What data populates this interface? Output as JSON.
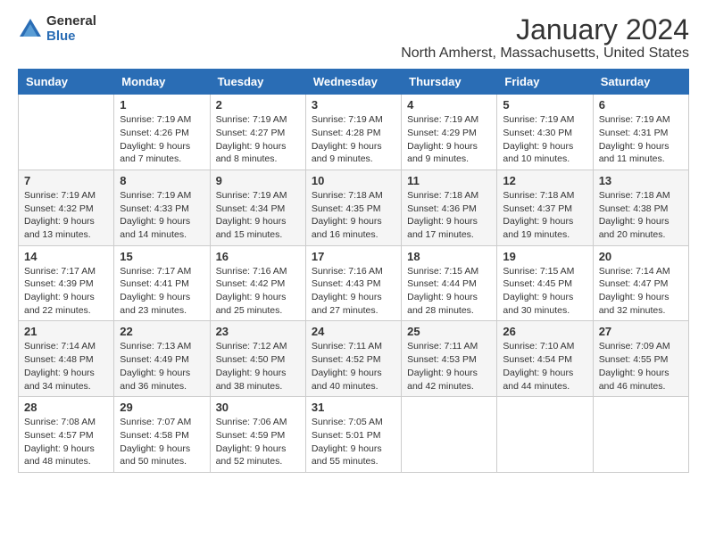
{
  "logo": {
    "general": "General",
    "blue": "Blue"
  },
  "title": "January 2024",
  "subtitle": "North Amherst, Massachusetts, United States",
  "weekdays": [
    "Sunday",
    "Monday",
    "Tuesday",
    "Wednesday",
    "Thursday",
    "Friday",
    "Saturday"
  ],
  "weeks": [
    [
      {
        "day": "",
        "sunrise": "",
        "sunset": "",
        "daylight": ""
      },
      {
        "day": "1",
        "sunrise": "Sunrise: 7:19 AM",
        "sunset": "Sunset: 4:26 PM",
        "daylight": "Daylight: 9 hours and 7 minutes."
      },
      {
        "day": "2",
        "sunrise": "Sunrise: 7:19 AM",
        "sunset": "Sunset: 4:27 PM",
        "daylight": "Daylight: 9 hours and 8 minutes."
      },
      {
        "day": "3",
        "sunrise": "Sunrise: 7:19 AM",
        "sunset": "Sunset: 4:28 PM",
        "daylight": "Daylight: 9 hours and 9 minutes."
      },
      {
        "day": "4",
        "sunrise": "Sunrise: 7:19 AM",
        "sunset": "Sunset: 4:29 PM",
        "daylight": "Daylight: 9 hours and 9 minutes."
      },
      {
        "day": "5",
        "sunrise": "Sunrise: 7:19 AM",
        "sunset": "Sunset: 4:30 PM",
        "daylight": "Daylight: 9 hours and 10 minutes."
      },
      {
        "day": "6",
        "sunrise": "Sunrise: 7:19 AM",
        "sunset": "Sunset: 4:31 PM",
        "daylight": "Daylight: 9 hours and 11 minutes."
      }
    ],
    [
      {
        "day": "7",
        "sunrise": "Sunrise: 7:19 AM",
        "sunset": "Sunset: 4:32 PM",
        "daylight": "Daylight: 9 hours and 13 minutes."
      },
      {
        "day": "8",
        "sunrise": "Sunrise: 7:19 AM",
        "sunset": "Sunset: 4:33 PM",
        "daylight": "Daylight: 9 hours and 14 minutes."
      },
      {
        "day": "9",
        "sunrise": "Sunrise: 7:19 AM",
        "sunset": "Sunset: 4:34 PM",
        "daylight": "Daylight: 9 hours and 15 minutes."
      },
      {
        "day": "10",
        "sunrise": "Sunrise: 7:18 AM",
        "sunset": "Sunset: 4:35 PM",
        "daylight": "Daylight: 9 hours and 16 minutes."
      },
      {
        "day": "11",
        "sunrise": "Sunrise: 7:18 AM",
        "sunset": "Sunset: 4:36 PM",
        "daylight": "Daylight: 9 hours and 17 minutes."
      },
      {
        "day": "12",
        "sunrise": "Sunrise: 7:18 AM",
        "sunset": "Sunset: 4:37 PM",
        "daylight": "Daylight: 9 hours and 19 minutes."
      },
      {
        "day": "13",
        "sunrise": "Sunrise: 7:18 AM",
        "sunset": "Sunset: 4:38 PM",
        "daylight": "Daylight: 9 hours and 20 minutes."
      }
    ],
    [
      {
        "day": "14",
        "sunrise": "Sunrise: 7:17 AM",
        "sunset": "Sunset: 4:39 PM",
        "daylight": "Daylight: 9 hours and 22 minutes."
      },
      {
        "day": "15",
        "sunrise": "Sunrise: 7:17 AM",
        "sunset": "Sunset: 4:41 PM",
        "daylight": "Daylight: 9 hours and 23 minutes."
      },
      {
        "day": "16",
        "sunrise": "Sunrise: 7:16 AM",
        "sunset": "Sunset: 4:42 PM",
        "daylight": "Daylight: 9 hours and 25 minutes."
      },
      {
        "day": "17",
        "sunrise": "Sunrise: 7:16 AM",
        "sunset": "Sunset: 4:43 PM",
        "daylight": "Daylight: 9 hours and 27 minutes."
      },
      {
        "day": "18",
        "sunrise": "Sunrise: 7:15 AM",
        "sunset": "Sunset: 4:44 PM",
        "daylight": "Daylight: 9 hours and 28 minutes."
      },
      {
        "day": "19",
        "sunrise": "Sunrise: 7:15 AM",
        "sunset": "Sunset: 4:45 PM",
        "daylight": "Daylight: 9 hours and 30 minutes."
      },
      {
        "day": "20",
        "sunrise": "Sunrise: 7:14 AM",
        "sunset": "Sunset: 4:47 PM",
        "daylight": "Daylight: 9 hours and 32 minutes."
      }
    ],
    [
      {
        "day": "21",
        "sunrise": "Sunrise: 7:14 AM",
        "sunset": "Sunset: 4:48 PM",
        "daylight": "Daylight: 9 hours and 34 minutes."
      },
      {
        "day": "22",
        "sunrise": "Sunrise: 7:13 AM",
        "sunset": "Sunset: 4:49 PM",
        "daylight": "Daylight: 9 hours and 36 minutes."
      },
      {
        "day": "23",
        "sunrise": "Sunrise: 7:12 AM",
        "sunset": "Sunset: 4:50 PM",
        "daylight": "Daylight: 9 hours and 38 minutes."
      },
      {
        "day": "24",
        "sunrise": "Sunrise: 7:11 AM",
        "sunset": "Sunset: 4:52 PM",
        "daylight": "Daylight: 9 hours and 40 minutes."
      },
      {
        "day": "25",
        "sunrise": "Sunrise: 7:11 AM",
        "sunset": "Sunset: 4:53 PM",
        "daylight": "Daylight: 9 hours and 42 minutes."
      },
      {
        "day": "26",
        "sunrise": "Sunrise: 7:10 AM",
        "sunset": "Sunset: 4:54 PM",
        "daylight": "Daylight: 9 hours and 44 minutes."
      },
      {
        "day": "27",
        "sunrise": "Sunrise: 7:09 AM",
        "sunset": "Sunset: 4:55 PM",
        "daylight": "Daylight: 9 hours and 46 minutes."
      }
    ],
    [
      {
        "day": "28",
        "sunrise": "Sunrise: 7:08 AM",
        "sunset": "Sunset: 4:57 PM",
        "daylight": "Daylight: 9 hours and 48 minutes."
      },
      {
        "day": "29",
        "sunrise": "Sunrise: 7:07 AM",
        "sunset": "Sunset: 4:58 PM",
        "daylight": "Daylight: 9 hours and 50 minutes."
      },
      {
        "day": "30",
        "sunrise": "Sunrise: 7:06 AM",
        "sunset": "Sunset: 4:59 PM",
        "daylight": "Daylight: 9 hours and 52 minutes."
      },
      {
        "day": "31",
        "sunrise": "Sunrise: 7:05 AM",
        "sunset": "Sunset: 5:01 PM",
        "daylight": "Daylight: 9 hours and 55 minutes."
      },
      {
        "day": "",
        "sunrise": "",
        "sunset": "",
        "daylight": ""
      },
      {
        "day": "",
        "sunrise": "",
        "sunset": "",
        "daylight": ""
      },
      {
        "day": "",
        "sunrise": "",
        "sunset": "",
        "daylight": ""
      }
    ]
  ]
}
